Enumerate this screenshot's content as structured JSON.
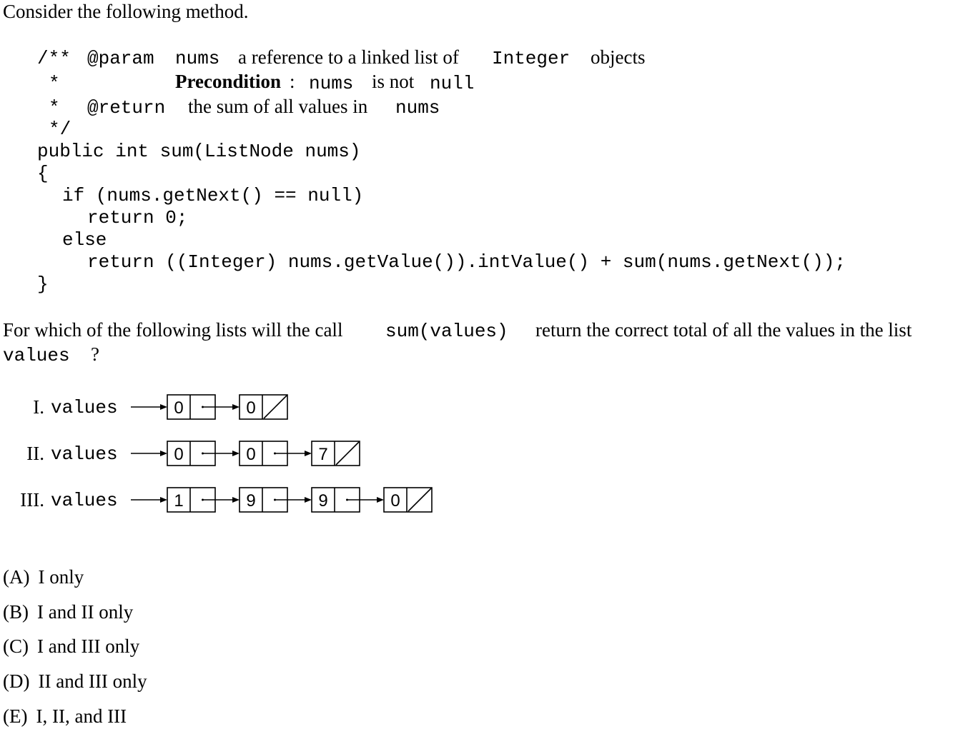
{
  "intro": "Consider the following method.",
  "code": {
    "doc1_open": "/**",
    "doc1_tag": "@param",
    "doc1_var": "nums",
    "doc1_text": "a reference to a linked list of",
    "doc1_type": "Integer",
    "doc1_tail": "objects",
    "doc2_star": "*",
    "doc2_bold": "Precondition",
    "doc2_colon": ":",
    "doc2_var": "nums",
    "doc2_text": "is not",
    "doc2_null": "null",
    "doc3_star": "*",
    "doc3_tag": "@return",
    "doc3_text": "the sum of all values in",
    "doc3_var": "nums",
    "doc4_close": "*/",
    "line_sig": "public int sum(ListNode nums)",
    "line_open": "{",
    "line_if": "if (nums.getNext() == null)",
    "line_ret0": "return 0;",
    "line_else": "else",
    "line_ret": "return ((Integer) nums.getValue()).intValue() + sum(nums.getNext());",
    "line_close": "}"
  },
  "question": {
    "part1": "For which of the following lists will the call",
    "call": "sum(values)",
    "part2": "return the correct total of all the values in the list",
    "var": "values",
    "mark": "?"
  },
  "lists": [
    {
      "label": "I.",
      "var": "values",
      "nodes": [
        "0",
        "0"
      ]
    },
    {
      "label": "II.",
      "var": "values",
      "nodes": [
        "0",
        "0",
        "7"
      ]
    },
    {
      "label": "III.",
      "var": "values",
      "nodes": [
        "1",
        "9",
        "9",
        "0"
      ]
    }
  ],
  "choices": [
    {
      "letter": "(A)",
      "text": "I only"
    },
    {
      "letter": "(B)",
      "text": "I and II only"
    },
    {
      "letter": "(C)",
      "text": "I and III only"
    },
    {
      "letter": "(D)",
      "text": "II and III only"
    },
    {
      "letter": "(E)",
      "text": "I, II, and III"
    }
  ]
}
